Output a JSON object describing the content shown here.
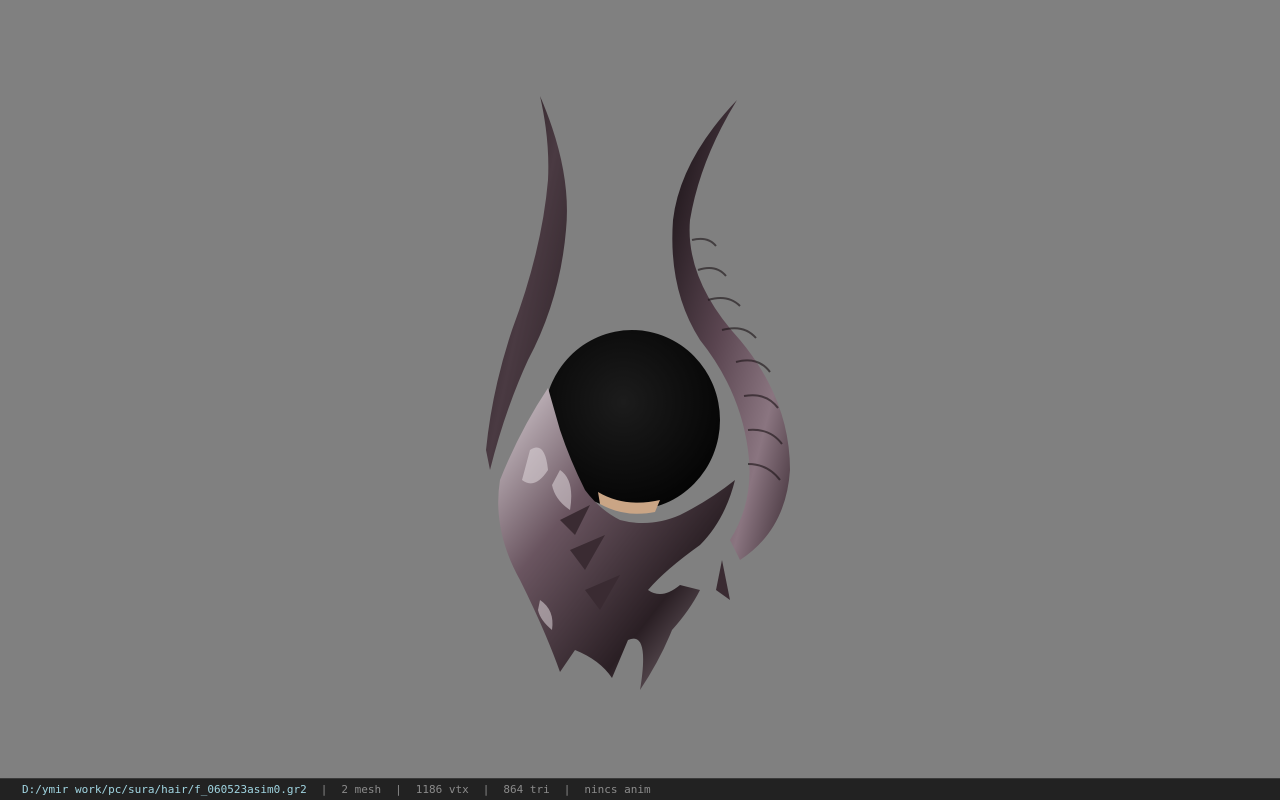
{
  "viewer": {
    "background_color": "#808080"
  },
  "status_bar": {
    "file_path": "D:/ymir work/pc/sura/hair/f_060523asim0.gr2",
    "separator": "|",
    "mesh_count": "2 mesh",
    "vertex_count": "1186 vtx",
    "triangle_count": "864 tri",
    "animation": "nincs anim",
    "path_color": "#9fd3df",
    "text_color": "#8a8a8a"
  }
}
